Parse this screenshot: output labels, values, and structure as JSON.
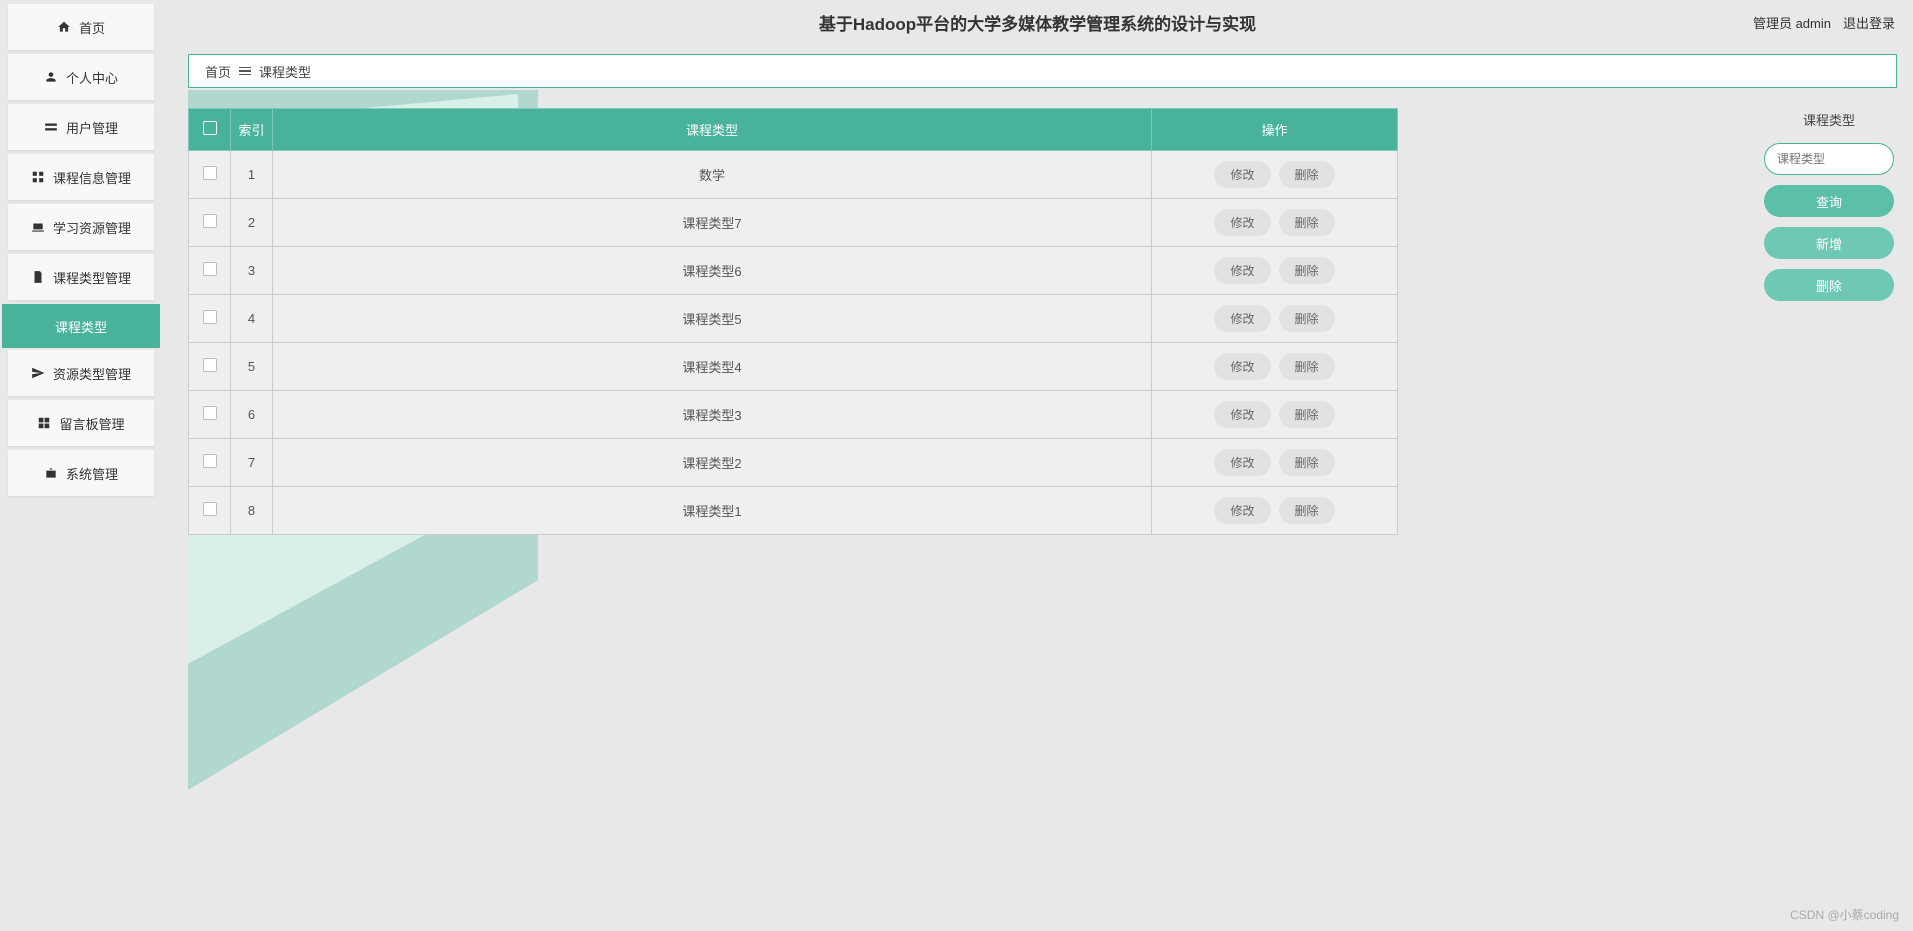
{
  "header": {
    "title": "基于Hadoop平台的大学多媒体教学管理系统的设计与实现",
    "user_label": "管理员 admin",
    "logout": "退出登录"
  },
  "sidebar": {
    "items": [
      {
        "label": "首页",
        "icon": "home"
      },
      {
        "label": "个人中心",
        "icon": "person"
      },
      {
        "label": "用户管理",
        "icon": "users"
      },
      {
        "label": "课程信息管理",
        "icon": "grid"
      },
      {
        "label": "学习资源管理",
        "icon": "laptop"
      },
      {
        "label": "课程类型管理",
        "icon": "doc"
      },
      {
        "label": "资源类型管理",
        "icon": "plane"
      },
      {
        "label": "留言板管理",
        "icon": "board"
      },
      {
        "label": "系统管理",
        "icon": "briefcase"
      }
    ],
    "active_sub": "课程类型"
  },
  "breadcrumb": {
    "home": "首页",
    "current": "课程类型"
  },
  "table": {
    "headers": {
      "index": "索引",
      "type": "课程类型",
      "action": "操作"
    },
    "edit_label": "修改",
    "delete_label": "删除",
    "rows": [
      {
        "index": "1",
        "type": "数学"
      },
      {
        "index": "2",
        "type": "课程类型7"
      },
      {
        "index": "3",
        "type": "课程类型6"
      },
      {
        "index": "4",
        "type": "课程类型5"
      },
      {
        "index": "5",
        "type": "课程类型4"
      },
      {
        "index": "6",
        "type": "课程类型3"
      },
      {
        "index": "7",
        "type": "课程类型2"
      },
      {
        "index": "8",
        "type": "课程类型1"
      }
    ]
  },
  "panel": {
    "title": "课程类型",
    "placeholder": "课程类型",
    "search": "查询",
    "add": "新增",
    "delete": "删除"
  },
  "watermark": "CSDN @小蔡coding"
}
